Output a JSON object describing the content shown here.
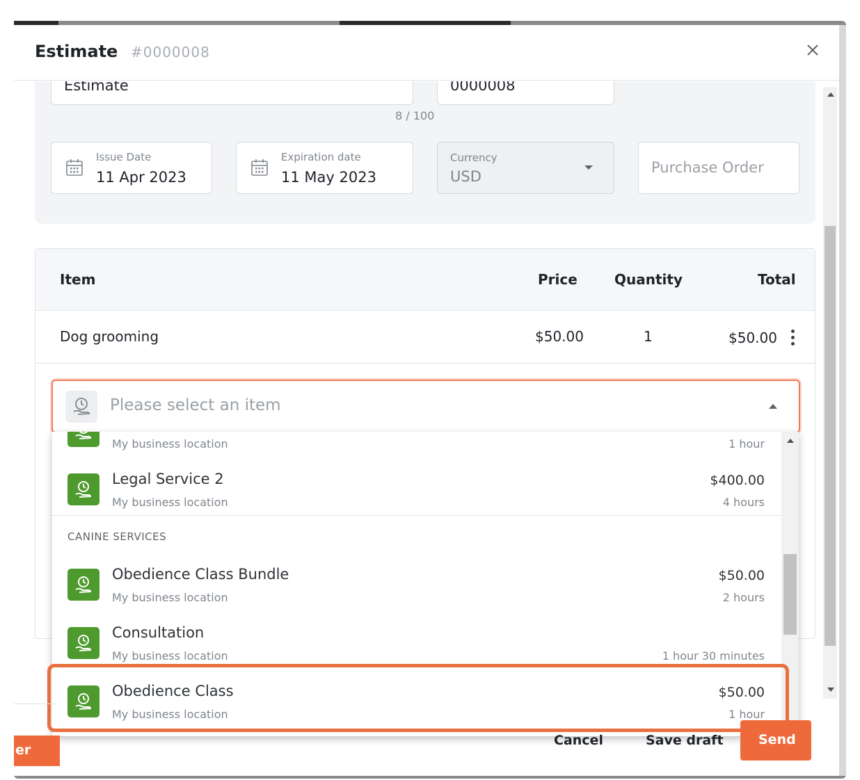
{
  "header": {
    "title": "Estimate",
    "number": "#0000008",
    "close_icon": "close-icon"
  },
  "form": {
    "title_value": "Estimate",
    "title_char_count": "8 / 100",
    "number_value": "0000008",
    "issue_date": {
      "label": "Issue Date",
      "value": "11 Apr 2023",
      "icon": "calendar-icon"
    },
    "expiration_date": {
      "label": "Expiration date",
      "value": "11 May 2023",
      "icon": "calendar-icon"
    },
    "currency": {
      "label": "Currency",
      "value": "USD"
    },
    "purchase_order": {
      "placeholder": "Purchase Order"
    }
  },
  "table": {
    "headers": {
      "item": "Item",
      "price": "Price",
      "quantity": "Quantity",
      "total": "Total"
    },
    "rows": [
      {
        "item": "Dog grooming",
        "price": "$50.00",
        "quantity": "1",
        "total": "$50.00"
      }
    ]
  },
  "item_select": {
    "placeholder": "Please select an item"
  },
  "dropdown": {
    "partial_item": {
      "location": "My business location",
      "duration": "1 hour"
    },
    "items_before_group": [
      {
        "name": "Legal Service 2",
        "location": "My business location",
        "price": "$400.00",
        "duration": "4 hours"
      }
    ],
    "group_label": "CANINE SERVICES",
    "group_items": [
      {
        "name": "Obedience Class Bundle",
        "location": "My business location",
        "price": "$50.00",
        "duration": "2 hours"
      },
      {
        "name": "Consultation",
        "location": "My business location",
        "price": "",
        "duration": "1 hour 30 minutes"
      },
      {
        "name": "Obedience Class",
        "location": "My business location",
        "price": "$50.00",
        "duration": "1 hour"
      }
    ]
  },
  "footer": {
    "cancel": "Cancel",
    "save_draft": "Save draft",
    "send": "Send",
    "left_button": "er"
  },
  "colors": {
    "accent": "#ef6a3a",
    "service_icon": "#4e9a2e",
    "highlight": "#e8703f"
  }
}
